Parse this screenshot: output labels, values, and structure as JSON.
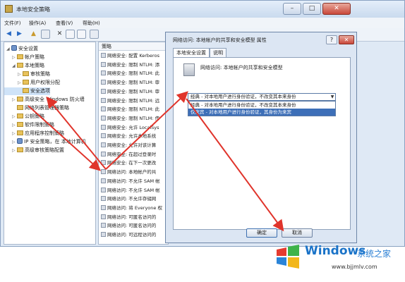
{
  "window": {
    "title": "本地安全策略",
    "minimize": "–",
    "maximize": "□",
    "close": "✕"
  },
  "menu": [
    "文件(F)",
    "操作(A)",
    "查看(V)",
    "帮助(H)"
  ],
  "toolbar": [
    "back-icon",
    "forward-icon",
    "up-icon",
    "folder-icon",
    "delete-icon",
    "properties-icon",
    "export-icon",
    "help-icon"
  ],
  "tree": [
    {
      "label": "安全设置",
      "level": 0,
      "exp": "◢",
      "icon": "shield"
    },
    {
      "label": "帐户策略",
      "level": 1,
      "exp": "▷",
      "icon": "folder"
    },
    {
      "label": "本地策略",
      "level": 1,
      "exp": "◢",
      "icon": "folder"
    },
    {
      "label": "审核策略",
      "level": 2,
      "exp": "▷",
      "icon": "folder"
    },
    {
      "label": "用户权限分配",
      "level": 2,
      "exp": "▷",
      "icon": "folder"
    },
    {
      "label": "安全选项",
      "level": 2,
      "exp": "",
      "icon": "folder"
    },
    {
      "label": "高级安全 Windows 防火墙",
      "level": 1,
      "exp": "▷",
      "icon": "folder"
    },
    {
      "label": "网络列表管理器策略",
      "level": 1,
      "exp": "",
      "icon": "folder"
    },
    {
      "label": "公钥策略",
      "level": 1,
      "exp": "▷",
      "icon": "folder"
    },
    {
      "label": "软件限制策略",
      "level": 1,
      "exp": "▷",
      "icon": "folder"
    },
    {
      "label": "应用程序控制策略",
      "level": 1,
      "exp": "▷",
      "icon": "folder"
    },
    {
      "label": "IP 安全策略，在 本地计算机",
      "level": 1,
      "exp": "▷",
      "icon": "shield"
    },
    {
      "label": "高级审核策略配置",
      "level": 1,
      "exp": "▷",
      "icon": "folder"
    }
  ],
  "policy_list": {
    "header": "策略",
    "rows": [
      "网络安全: 配置 Kerberos",
      "网络安全: 限制 NTLM: 添",
      "网络安全: 限制 NTLM: 此",
      "网络安全: 限制 NTLM: 审",
      "网络安全: 限制 NTLM: 审",
      "网络安全: 限制 NTLM: 远",
      "网络安全: 限制 NTLM: 此",
      "网络安全: 限制 NTLM: 传",
      "网络安全: 允许 LocalSys",
      "网络安全: 允许本地系统",
      "网络安全: 允许对该计算",
      "网络安全: 在超过登录时",
      "网络安全: 在下一次更改",
      "网络访问: 本地帐户的共",
      "网络访问: 不允许 SAM 帐",
      "网络访问: 不允许 SAM 帐",
      "网络访问: 不允许存储网",
      "网络访问: 将 Everyone 权",
      "网络访问: 可匿名访问的",
      "网络访问: 可匿名访问的",
      "网络访问: 可远程访问的"
    ]
  },
  "dialog": {
    "title": "网络访问: 本地帐户的共享和安全模型 属性",
    "help": "?",
    "close": "✕",
    "tabs": [
      "本地安全设置",
      "说明"
    ],
    "policy_name": "网络访问: 本地帐户的共享和安全模型",
    "combo_value": "经典 - 对本地用户进行身份验证，不改变其本来身份",
    "combo_arrow": "▼",
    "options": [
      "经典 - 对本地用户进行身份验证，不改变其本来身份",
      "仅来宾 - 对本地用户进行身份验证，其身份为来宾"
    ],
    "ok": "确定",
    "cancel": "取消"
  },
  "watermark": {
    "brand": "Windows",
    "cn": "系统之家",
    "url": "www.bjjmlv.com"
  },
  "colors": {
    "arrow": "#e0342b",
    "accent": "#3d6fb8"
  }
}
